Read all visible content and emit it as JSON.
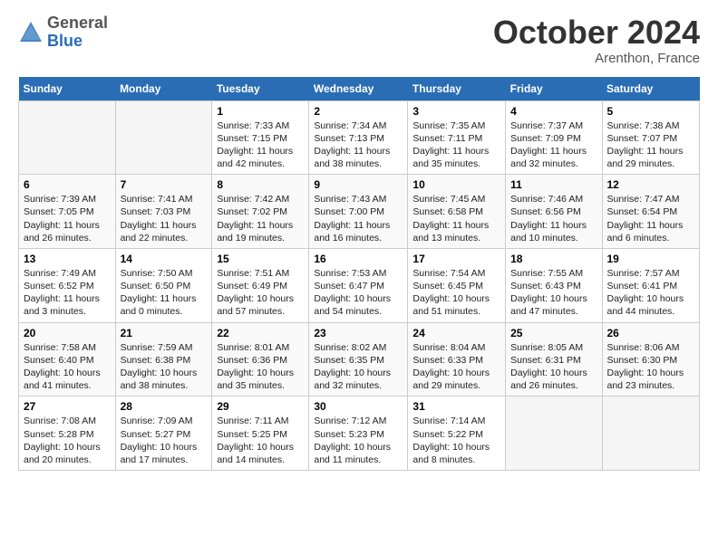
{
  "header": {
    "logo_general": "General",
    "logo_blue": "Blue",
    "month_title": "October 2024",
    "location": "Arenthon, France"
  },
  "days_of_week": [
    "Sunday",
    "Monday",
    "Tuesday",
    "Wednesday",
    "Thursday",
    "Friday",
    "Saturday"
  ],
  "weeks": [
    [
      {
        "day": "",
        "sunrise": "",
        "sunset": "",
        "daylight": "",
        "empty": true
      },
      {
        "day": "",
        "sunrise": "",
        "sunset": "",
        "daylight": "",
        "empty": true
      },
      {
        "day": "1",
        "sunrise": "Sunrise: 7:33 AM",
        "sunset": "Sunset: 7:15 PM",
        "daylight": "Daylight: 11 hours and 42 minutes.",
        "empty": false
      },
      {
        "day": "2",
        "sunrise": "Sunrise: 7:34 AM",
        "sunset": "Sunset: 7:13 PM",
        "daylight": "Daylight: 11 hours and 38 minutes.",
        "empty": false
      },
      {
        "day": "3",
        "sunrise": "Sunrise: 7:35 AM",
        "sunset": "Sunset: 7:11 PM",
        "daylight": "Daylight: 11 hours and 35 minutes.",
        "empty": false
      },
      {
        "day": "4",
        "sunrise": "Sunrise: 7:37 AM",
        "sunset": "Sunset: 7:09 PM",
        "daylight": "Daylight: 11 hours and 32 minutes.",
        "empty": false
      },
      {
        "day": "5",
        "sunrise": "Sunrise: 7:38 AM",
        "sunset": "Sunset: 7:07 PM",
        "daylight": "Daylight: 11 hours and 29 minutes.",
        "empty": false
      }
    ],
    [
      {
        "day": "6",
        "sunrise": "Sunrise: 7:39 AM",
        "sunset": "Sunset: 7:05 PM",
        "daylight": "Daylight: 11 hours and 26 minutes.",
        "empty": false
      },
      {
        "day": "7",
        "sunrise": "Sunrise: 7:41 AM",
        "sunset": "Sunset: 7:03 PM",
        "daylight": "Daylight: 11 hours and 22 minutes.",
        "empty": false
      },
      {
        "day": "8",
        "sunrise": "Sunrise: 7:42 AM",
        "sunset": "Sunset: 7:02 PM",
        "daylight": "Daylight: 11 hours and 19 minutes.",
        "empty": false
      },
      {
        "day": "9",
        "sunrise": "Sunrise: 7:43 AM",
        "sunset": "Sunset: 7:00 PM",
        "daylight": "Daylight: 11 hours and 16 minutes.",
        "empty": false
      },
      {
        "day": "10",
        "sunrise": "Sunrise: 7:45 AM",
        "sunset": "Sunset: 6:58 PM",
        "daylight": "Daylight: 11 hours and 13 minutes.",
        "empty": false
      },
      {
        "day": "11",
        "sunrise": "Sunrise: 7:46 AM",
        "sunset": "Sunset: 6:56 PM",
        "daylight": "Daylight: 11 hours and 10 minutes.",
        "empty": false
      },
      {
        "day": "12",
        "sunrise": "Sunrise: 7:47 AM",
        "sunset": "Sunset: 6:54 PM",
        "daylight": "Daylight: 11 hours and 6 minutes.",
        "empty": false
      }
    ],
    [
      {
        "day": "13",
        "sunrise": "Sunrise: 7:49 AM",
        "sunset": "Sunset: 6:52 PM",
        "daylight": "Daylight: 11 hours and 3 minutes.",
        "empty": false
      },
      {
        "day": "14",
        "sunrise": "Sunrise: 7:50 AM",
        "sunset": "Sunset: 6:50 PM",
        "daylight": "Daylight: 11 hours and 0 minutes.",
        "empty": false
      },
      {
        "day": "15",
        "sunrise": "Sunrise: 7:51 AM",
        "sunset": "Sunset: 6:49 PM",
        "daylight": "Daylight: 10 hours and 57 minutes.",
        "empty": false
      },
      {
        "day": "16",
        "sunrise": "Sunrise: 7:53 AM",
        "sunset": "Sunset: 6:47 PM",
        "daylight": "Daylight: 10 hours and 54 minutes.",
        "empty": false
      },
      {
        "day": "17",
        "sunrise": "Sunrise: 7:54 AM",
        "sunset": "Sunset: 6:45 PM",
        "daylight": "Daylight: 10 hours and 51 minutes.",
        "empty": false
      },
      {
        "day": "18",
        "sunrise": "Sunrise: 7:55 AM",
        "sunset": "Sunset: 6:43 PM",
        "daylight": "Daylight: 10 hours and 47 minutes.",
        "empty": false
      },
      {
        "day": "19",
        "sunrise": "Sunrise: 7:57 AM",
        "sunset": "Sunset: 6:41 PM",
        "daylight": "Daylight: 10 hours and 44 minutes.",
        "empty": false
      }
    ],
    [
      {
        "day": "20",
        "sunrise": "Sunrise: 7:58 AM",
        "sunset": "Sunset: 6:40 PM",
        "daylight": "Daylight: 10 hours and 41 minutes.",
        "empty": false
      },
      {
        "day": "21",
        "sunrise": "Sunrise: 7:59 AM",
        "sunset": "Sunset: 6:38 PM",
        "daylight": "Daylight: 10 hours and 38 minutes.",
        "empty": false
      },
      {
        "day": "22",
        "sunrise": "Sunrise: 8:01 AM",
        "sunset": "Sunset: 6:36 PM",
        "daylight": "Daylight: 10 hours and 35 minutes.",
        "empty": false
      },
      {
        "day": "23",
        "sunrise": "Sunrise: 8:02 AM",
        "sunset": "Sunset: 6:35 PM",
        "daylight": "Daylight: 10 hours and 32 minutes.",
        "empty": false
      },
      {
        "day": "24",
        "sunrise": "Sunrise: 8:04 AM",
        "sunset": "Sunset: 6:33 PM",
        "daylight": "Daylight: 10 hours and 29 minutes.",
        "empty": false
      },
      {
        "day": "25",
        "sunrise": "Sunrise: 8:05 AM",
        "sunset": "Sunset: 6:31 PM",
        "daylight": "Daylight: 10 hours and 26 minutes.",
        "empty": false
      },
      {
        "day": "26",
        "sunrise": "Sunrise: 8:06 AM",
        "sunset": "Sunset: 6:30 PM",
        "daylight": "Daylight: 10 hours and 23 minutes.",
        "empty": false
      }
    ],
    [
      {
        "day": "27",
        "sunrise": "Sunrise: 7:08 AM",
        "sunset": "Sunset: 5:28 PM",
        "daylight": "Daylight: 10 hours and 20 minutes.",
        "empty": false
      },
      {
        "day": "28",
        "sunrise": "Sunrise: 7:09 AM",
        "sunset": "Sunset: 5:27 PM",
        "daylight": "Daylight: 10 hours and 17 minutes.",
        "empty": false
      },
      {
        "day": "29",
        "sunrise": "Sunrise: 7:11 AM",
        "sunset": "Sunset: 5:25 PM",
        "daylight": "Daylight: 10 hours and 14 minutes.",
        "empty": false
      },
      {
        "day": "30",
        "sunrise": "Sunrise: 7:12 AM",
        "sunset": "Sunset: 5:23 PM",
        "daylight": "Daylight: 10 hours and 11 minutes.",
        "empty": false
      },
      {
        "day": "31",
        "sunrise": "Sunrise: 7:14 AM",
        "sunset": "Sunset: 5:22 PM",
        "daylight": "Daylight: 10 hours and 8 minutes.",
        "empty": false
      },
      {
        "day": "",
        "sunrise": "",
        "sunset": "",
        "daylight": "",
        "empty": true
      },
      {
        "day": "",
        "sunrise": "",
        "sunset": "",
        "daylight": "",
        "empty": true
      }
    ]
  ]
}
